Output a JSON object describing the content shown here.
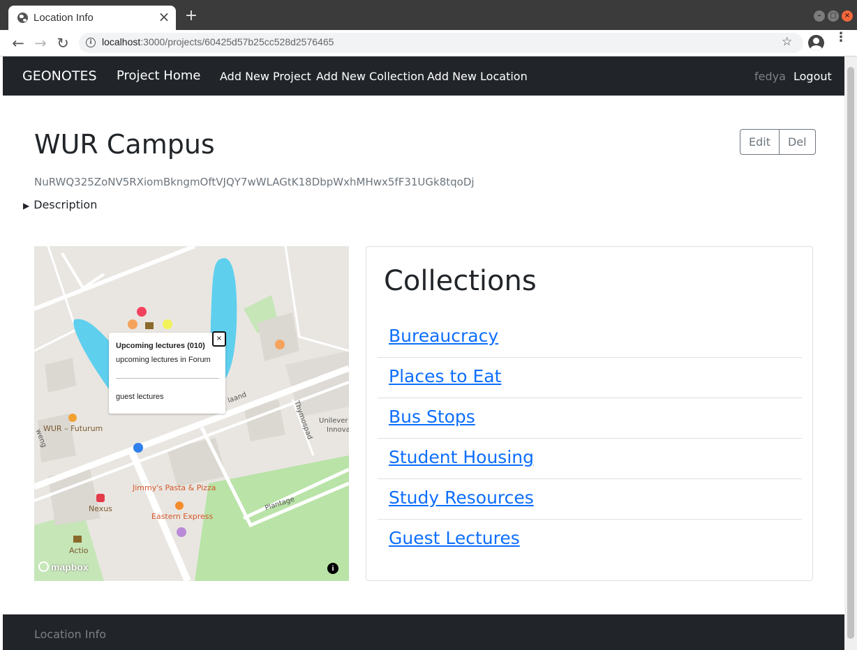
{
  "browser": {
    "tab_title": "Location Info",
    "tab_close": "×",
    "new_tab": "+",
    "url_host": "localhost",
    "url_path": ":3000/projects/60425d57b25cc528d2576465",
    "back": "←",
    "forward": "→",
    "reload": "↻",
    "star": "☆",
    "menu": "⋮",
    "minimize": "–",
    "maximize": "□",
    "close": "×"
  },
  "navbar": {
    "brand": "GEONOTES",
    "links": [
      "Project Home",
      "Add New Project",
      "Add New Collection",
      "Add New Location"
    ],
    "user": "fedya",
    "logout": "Logout"
  },
  "project": {
    "title": "WUR Campus",
    "edit_label": "Edit",
    "delete_label": "Del",
    "token": "NuRWQ325ZoNV5RXiomBkngmOftVJQY7wWLAGtK18DbpWxhMHwx5fF31UGk8tqoDj",
    "description_toggle": "Description"
  },
  "map": {
    "popup": {
      "title": "Upcoming lectures (010)",
      "description": "upcoming lectures in Forum",
      "note": "guest lectures",
      "close": "×"
    },
    "labels": {
      "futurum": "WUR – Futurum",
      "jimmys": "Jimmy's Pasta & Pizza",
      "eastern": "Eastern Express",
      "nexus": "Nexus",
      "actio": "Actio",
      "unilever_1": "Unilever",
      "unilever_2": "Innova",
      "plantage": "Plantage",
      "thymos": "Thymospad",
      "laan": "laand",
      "weg": "weng"
    },
    "logo": "mapbox",
    "info": "i",
    "marker_colors": {
      "red": "#f4425e",
      "orange": "#f5a35c",
      "yellow": "#f2f25a",
      "blue": "#2f7fef",
      "purple": "#b98ad8"
    }
  },
  "collections": {
    "title": "Collections",
    "items": [
      "Bureaucracy",
      "Places to Eat",
      "Bus Stops",
      "Student Housing",
      "Study Resources",
      "Guest Lectures"
    ]
  },
  "footer": {
    "text": "Location Info"
  }
}
